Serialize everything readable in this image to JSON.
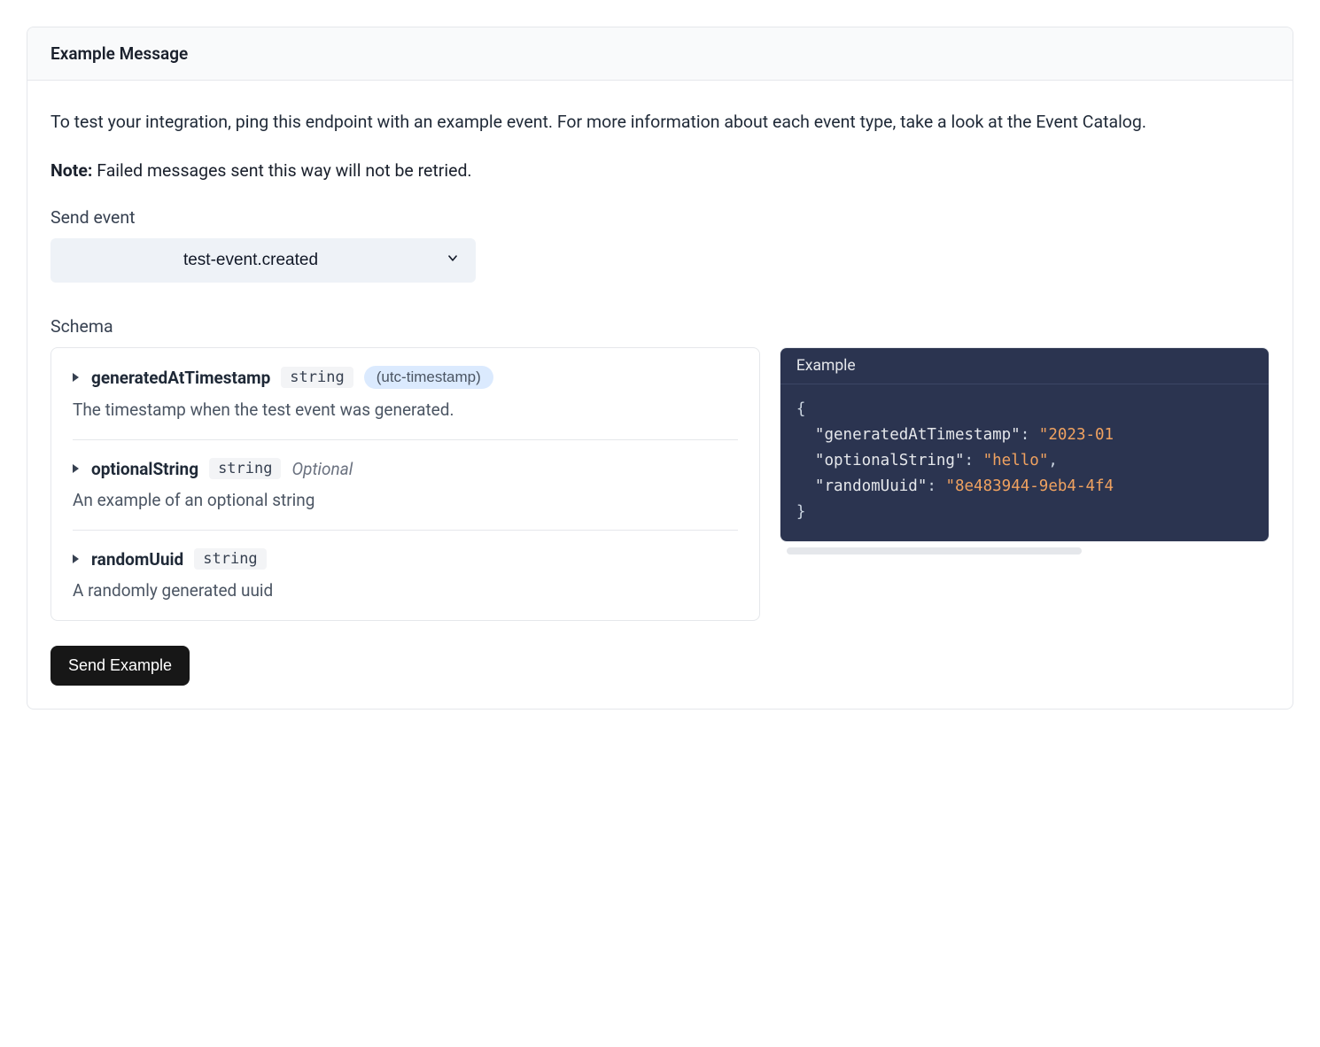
{
  "header": {
    "title": "Example Message"
  },
  "description": "To test your integration, ping this endpoint with an example event. For more information about each event type, take a look at the Event Catalog.",
  "note": {
    "label": "Note:",
    "text": "Failed messages sent this way will not be retried."
  },
  "sendEvent": {
    "label": "Send event",
    "selected": "test-event.created"
  },
  "schema": {
    "label": "Schema",
    "fields": [
      {
        "name": "generatedAtTimestamp",
        "type": "string",
        "format": "(utc-timestamp)",
        "optional": false,
        "description": "The timestamp when the test event was generated."
      },
      {
        "name": "optionalString",
        "type": "string",
        "format": "",
        "optional": true,
        "optionalLabel": "Optional",
        "description": "An example of an optional string"
      },
      {
        "name": "randomUuid",
        "type": "string",
        "format": "",
        "optional": false,
        "description": "A randomly generated uuid"
      }
    ]
  },
  "example": {
    "header": "Example",
    "json": {
      "generatedAtTimestamp": "2023-01",
      "optionalString": "hello",
      "randomUuid": "8e483944-9eb4-4f4"
    }
  },
  "actions": {
    "sendExample": "Send Example"
  }
}
